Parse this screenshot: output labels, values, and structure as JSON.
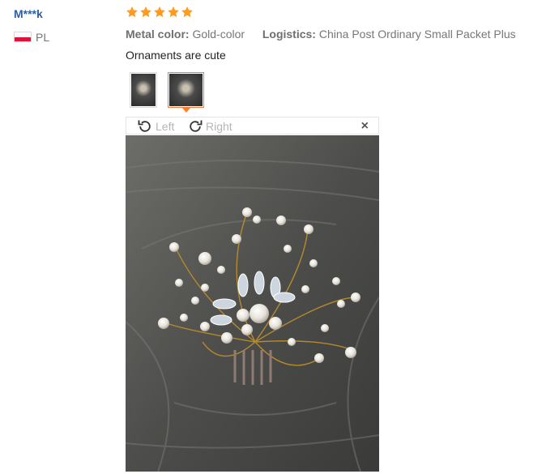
{
  "review": {
    "user": "M***k",
    "country": "PL",
    "rating": 5,
    "attributes": [
      {
        "label": "Metal color:",
        "value": "Gold-color"
      },
      {
        "label": "Logistics:",
        "value": "China Post Ordinary Small Packet Plus"
      }
    ],
    "comment": "Ornaments are cute",
    "thumbnails": [
      {
        "name": "review-photo-1",
        "active": false
      },
      {
        "name": "review-photo-2",
        "active": true
      }
    ]
  },
  "viewer": {
    "rotate_left": "Left",
    "rotate_right": "Right",
    "close": "×"
  },
  "colors": {
    "star": "#ff9b1e",
    "flag_red": "#dc143c",
    "username": "#2b5fa5",
    "active_border": "#ff7d2a"
  },
  "icons": [
    "flag-pl-icon",
    "star-icon",
    "rotate-left-icon",
    "rotate-right-icon",
    "close-icon"
  ]
}
